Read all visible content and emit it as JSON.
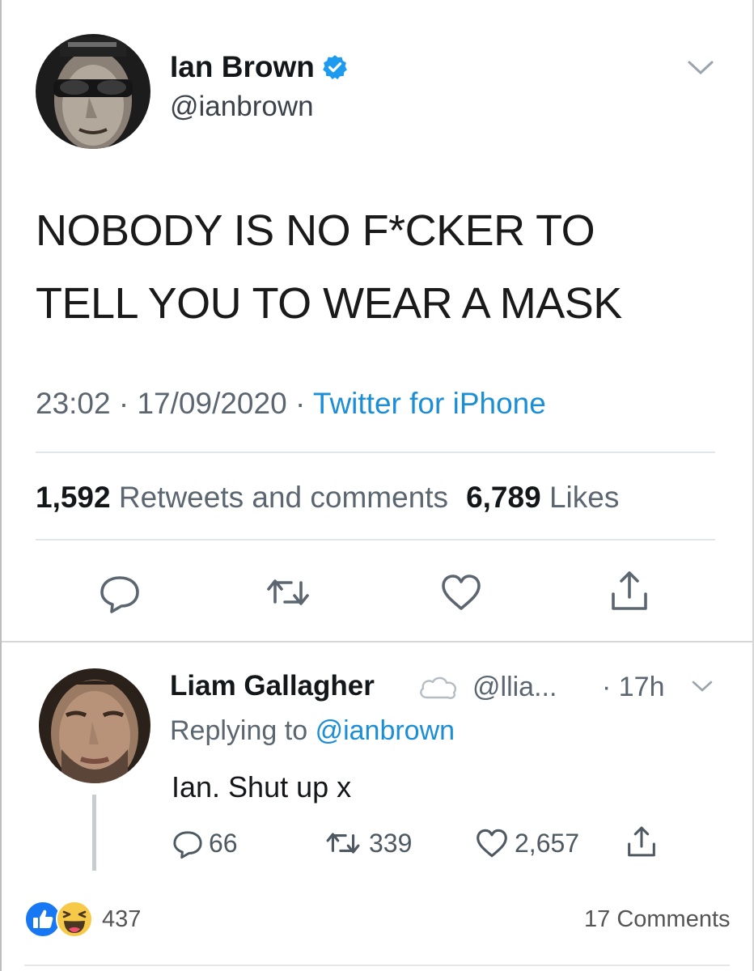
{
  "main_tweet": {
    "author_name": "Ian Brown",
    "handle": "@ianbrown",
    "verified": true,
    "text_lines": [
      "NOBODY IS NO F*CKER TO",
      "TELL YOU TO WEAR A MASK"
    ],
    "time": "23:02",
    "date": "17/09/2020",
    "separator": "·",
    "source": "Twitter for iPhone",
    "retweets_count": "1,592",
    "retweets_label": "Retweets and comments",
    "likes_count": "6,789",
    "likes_label": "Likes",
    "icons": [
      "reply-icon",
      "retweet-icon",
      "like-icon",
      "share-icon",
      "chevron-down-icon",
      "verified-badge-icon"
    ]
  },
  "reply_tweet": {
    "author_name": "Liam Gallagher",
    "handle": "@llia...",
    "time": "· 17h",
    "replying_prefix": "Replying to",
    "replying_to": "@ianbrown",
    "text": "Ian. Shut up x",
    "reply_count": "66",
    "retweet_count": "339",
    "like_count": "2,657",
    "icons": [
      "cloud-icon",
      "reply-icon",
      "retweet-icon",
      "like-icon",
      "share-icon",
      "chevron-down-icon"
    ]
  },
  "facebook_footer": {
    "reaction_count": "437",
    "comments": "17 Comments",
    "reactions": [
      "like-reaction-icon",
      "haha-reaction-icon"
    ]
  },
  "colors": {
    "twitter_blue": "#1b8ed6",
    "text_dark": "#14171a",
    "text_gray": "#5b6670",
    "facebook_blue": "#1877f2",
    "haha_yellow": "#f7c948"
  }
}
